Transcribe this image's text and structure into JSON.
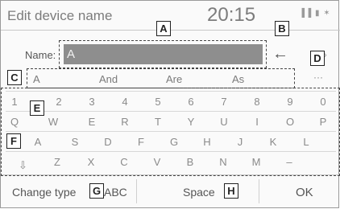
{
  "header": {
    "title": "Edit device name",
    "clock": "20:15",
    "status_icons": "▐▐ ▮ ✶"
  },
  "name_row": {
    "label": "Name:",
    "value": "A",
    "backspace_glyph": "←",
    "more_glyph": "»"
  },
  "suggestions": [
    "A",
    "And",
    "Are",
    "As"
  ],
  "suggestions_more": "···",
  "keyboard": {
    "row1": [
      "1",
      "2",
      "3",
      "4",
      "5",
      "6",
      "7",
      "8",
      "9",
      "0"
    ],
    "row2": [
      "Q",
      "W",
      "E",
      "R",
      "T",
      "Y",
      "U",
      "I",
      "O",
      "P"
    ],
    "row3": [
      "A",
      "S",
      "D",
      "F",
      "G",
      "H",
      "J",
      "K",
      "L"
    ],
    "row4": [
      "Z",
      "X",
      "C",
      "V",
      "B",
      "N",
      "M",
      "–"
    ],
    "shift_glyph": "⇩"
  },
  "bottom_bar": {
    "change_type": "Change type",
    "abc": "ABC",
    "space": "Space",
    "ok": "OK"
  },
  "callouts": {
    "a": "A",
    "b": "B",
    "c": "C",
    "d": "D",
    "e": "E",
    "f": "F",
    "g": "G",
    "h": "H"
  }
}
